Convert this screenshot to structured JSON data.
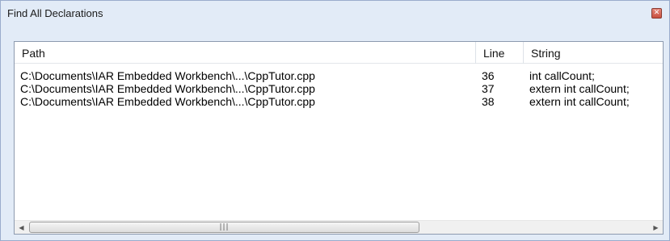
{
  "window": {
    "title": "Find All Declarations"
  },
  "columns": {
    "path": "Path",
    "line": "Line",
    "string": "String"
  },
  "rows": [
    {
      "path": "C:\\Documents\\IAR Embedded Workbench\\...\\CppTutor.cpp",
      "line": "36",
      "string": "int callCount;"
    },
    {
      "path": "C:\\Documents\\IAR Embedded Workbench\\...\\CppTutor.cpp",
      "line": "37",
      "string": "extern int callCount;"
    },
    {
      "path": "C:\\Documents\\IAR Embedded Workbench\\...\\CppTutor.cpp",
      "line": "38",
      "string": "extern int callCount;"
    }
  ],
  "icons": {
    "close": "close-icon",
    "scroll_left": "arrow-left-icon",
    "scroll_right": "arrow-right-icon",
    "grip": "grip-icon"
  },
  "colors": {
    "window_bg": "#e2ebf7",
    "close_button": "#c8503f"
  }
}
